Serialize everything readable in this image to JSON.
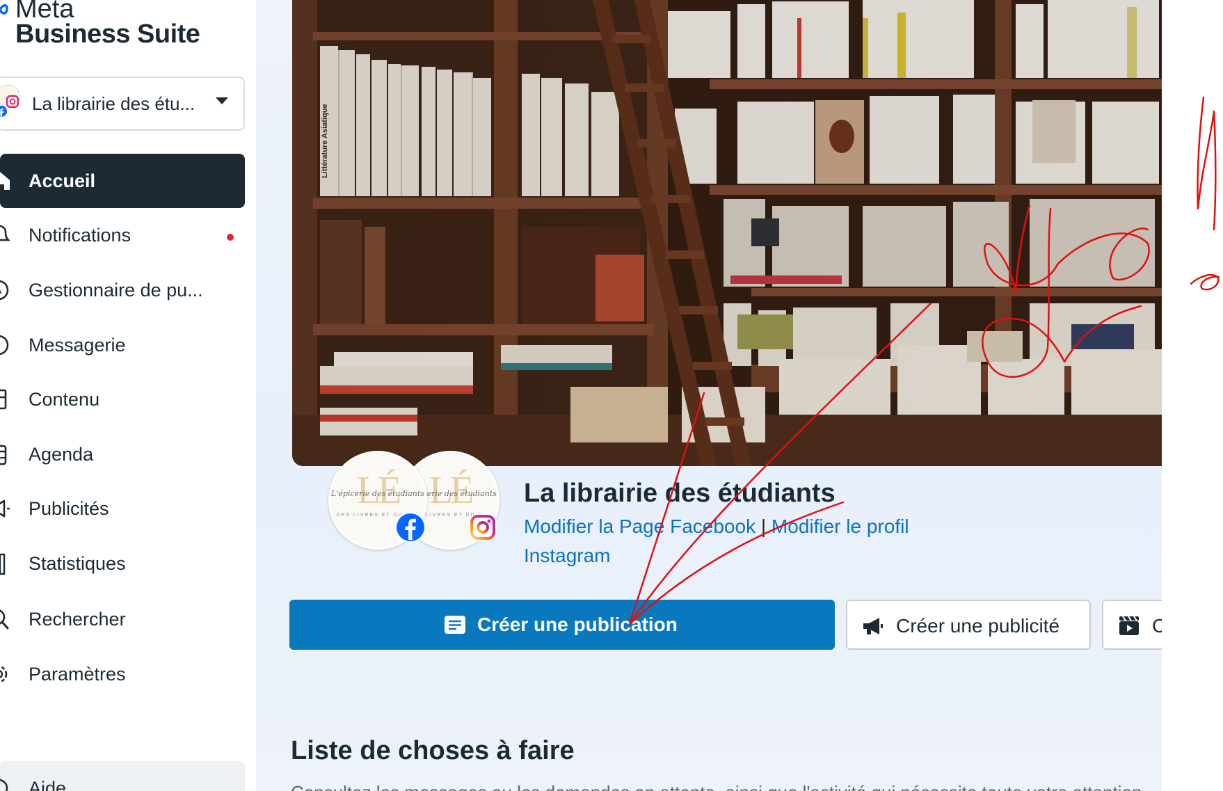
{
  "brand": {
    "line1": "Meta",
    "line2": "Business Suite"
  },
  "account": {
    "name": "La librairie des étu..."
  },
  "nav": [
    {
      "label": "Accueil",
      "icon": "home-icon",
      "active": true
    },
    {
      "label": "Notifications",
      "icon": "bell-icon",
      "badge": true
    },
    {
      "label": "Gestionnaire de pu...",
      "icon": "compass-icon"
    },
    {
      "label": "Messagerie",
      "icon": "chat-bubble-icon"
    },
    {
      "label": "Contenu",
      "icon": "content-icon"
    },
    {
      "label": "Agenda",
      "icon": "calendar-icon"
    },
    {
      "label": "Publicités",
      "icon": "megaphone-icon"
    },
    {
      "label": "Statistiques",
      "icon": "bar-chart-icon"
    },
    {
      "label": "Rechercher",
      "icon": "search-icon"
    },
    {
      "label": "Paramètres",
      "icon": "gear-icon"
    },
    {
      "label": "Aide",
      "icon": "help-icon"
    }
  ],
  "profile": {
    "name": "La librairie des étudiants",
    "links": {
      "edit_facebook": "Modifier la Page Facebook",
      "separator": "|",
      "edit_instagram_line1": "Modifier le profil",
      "edit_instagram_line2": "Instagram"
    },
    "logo_mono": "LÉ",
    "logo_script": "L'épicerie des étudiants",
    "logo_small": "DES LIVRES ET DU C..."
  },
  "actions": {
    "create_post": "Créer une publication",
    "create_ad": "Créer une publicité",
    "create_reel": "C"
  },
  "todo": {
    "title": "Liste de choses à faire",
    "subtitle": "Consultez les messages ou les demandes en attente, ainsi que l'activité qui nécessite toute votre attention."
  },
  "colors": {
    "primary": "#0a78be",
    "sidebar_active": "#1c2b33",
    "link": "#0a73bd",
    "annotation": "#e01010",
    "notification_dot": "#e0263e"
  }
}
